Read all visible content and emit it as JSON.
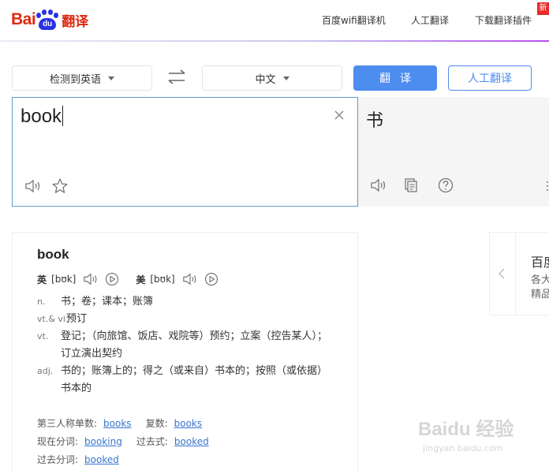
{
  "header": {
    "logo": {
      "bai": "Bai",
      "du": "du",
      "fanyi": "翻译"
    },
    "nav": [
      "百度wifi翻译机",
      "人工翻译",
      "下载翻译插件"
    ],
    "new_badge": "新"
  },
  "toolbar": {
    "source_lang": "检测到英语",
    "target_lang": "中文",
    "translate_label": "翻译",
    "human_label": "人工翻译"
  },
  "input": {
    "text": "book"
  },
  "output": {
    "text": "书"
  },
  "dictionary": {
    "word": "book",
    "phonetics": [
      {
        "label": "英",
        "ipa": "[bʊk]"
      },
      {
        "label": "美",
        "ipa": "[bʊk]"
      }
    ],
    "senses": [
      {
        "pos": "n.",
        "def": "书；卷；课本；账簿"
      },
      {
        "pos": "vt.& vi.",
        "def": "预订"
      },
      {
        "pos": "vt.",
        "def": "登记；（向旅馆、饭店、戏院等）预约；立案（控告某人）；订立演出契约"
      },
      {
        "pos": "adj.",
        "def": "书的；账簿上的；得之（或来自）书本的；按照（或依据）书本的"
      }
    ],
    "forms": {
      "third_person_label": "第三人称单数:",
      "third_person": "books",
      "plural_label": "复数:",
      "plural": "books",
      "present_participle_label": "现在分词:",
      "present_participle": "booking",
      "past_tense_label": "过去式:",
      "past_tense": "booked",
      "past_participle_label": "过去分词:",
      "past_participle": "booked"
    }
  },
  "side_card": {
    "title": "百度",
    "line1": "各大",
    "line2": "精品"
  },
  "watermark": {
    "top": "Baidu 经验",
    "bottom": "jingyan.baidu.com"
  },
  "colors": {
    "brand_red": "#de2910",
    "brand_blue": "#2932e1",
    "accent": "#4e8df0",
    "link": "#3775d0"
  },
  "icons": [
    "swap-icon",
    "clear-icon",
    "speaker-icon",
    "star-icon",
    "copy-icon",
    "help-icon",
    "replay-icon",
    "chevron-left-icon"
  ]
}
